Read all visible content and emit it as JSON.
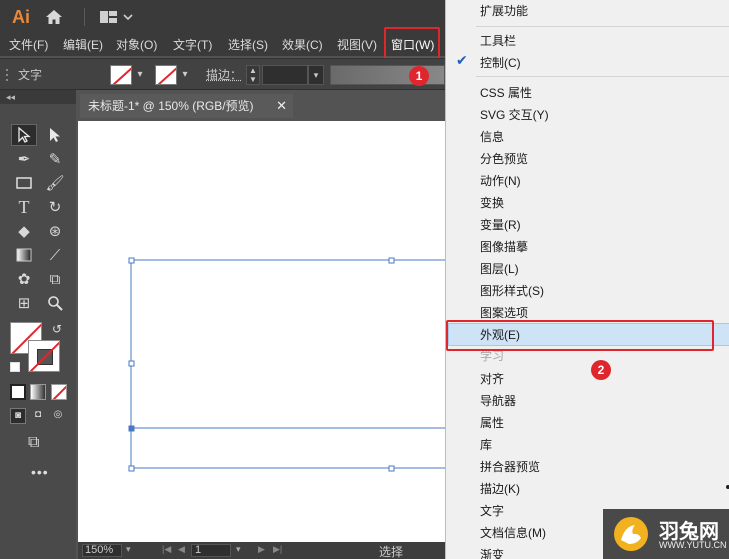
{
  "app": {
    "logo": "Ai"
  },
  "menubar": {
    "items": [
      "文件(F)",
      "编辑(E)",
      "对象(O)",
      "文字(T)",
      "选择(S)",
      "效果(C)",
      "视图(V)",
      "窗口(W)"
    ]
  },
  "control_bar": {
    "type_label": "文字",
    "stroke_label": "描边："
  },
  "document": {
    "tab_title": "未标题-1* @ 150% (RGB/预览)",
    "close_glyph": "✕"
  },
  "statusbar": {
    "zoom": "150%",
    "page": "1",
    "mode": "选择"
  },
  "window_menu": {
    "items": [
      {
        "label": "扩展功能"
      },
      {
        "label": "工具栏"
      },
      {
        "label": "控制(C)",
        "checked": true
      },
      {
        "label": "CSS 属性"
      },
      {
        "label": "SVG 交互(Y)"
      },
      {
        "label": "信息"
      },
      {
        "label": "分色预览"
      },
      {
        "label": "动作(N)"
      },
      {
        "label": "变换"
      },
      {
        "label": "变量(R)"
      },
      {
        "label": "图像描摹"
      },
      {
        "label": "图层(L)"
      },
      {
        "label": "图形样式(S)"
      },
      {
        "label": "图案选项"
      },
      {
        "label": "外观(E)",
        "highlighted": true
      },
      {
        "label": "学习",
        "disabled": true
      },
      {
        "label": "对齐"
      },
      {
        "label": "导航器"
      },
      {
        "label": "属性"
      },
      {
        "label": "库"
      },
      {
        "label": "拼合器预览"
      },
      {
        "label": "描边(K)"
      },
      {
        "label": "文字"
      },
      {
        "label": "文档信息(M)"
      },
      {
        "label": "渐变"
      }
    ]
  },
  "annotations": {
    "step1": "1",
    "step2": "2"
  },
  "watermark": {
    "text": "羽兔网",
    "url": "WWW.YUTU.CN"
  },
  "colors": {
    "accent_red": "#e0262d",
    "menu_highlight": "#cfe3f6",
    "selection_blue": "#4a78c4",
    "logo_orange": "#e8893a"
  }
}
